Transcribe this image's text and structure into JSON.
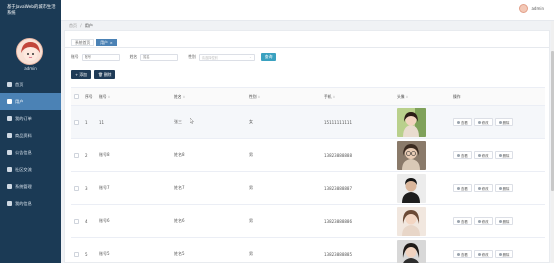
{
  "sidebar": {
    "app_title": "基于JavaWeb的城市生活系统",
    "username": "admin",
    "items": [
      {
        "label": "首页",
        "icon": "home-icon"
      },
      {
        "label": "用户",
        "icon": "user-icon"
      },
      {
        "label": "我的订单",
        "icon": "order-icon"
      },
      {
        "label": "商品资料",
        "icon": "goods-icon"
      },
      {
        "label": "公告信息",
        "icon": "notice-icon"
      },
      {
        "label": "社区交流",
        "icon": "community-icon"
      },
      {
        "label": "系统管理",
        "icon": "settings-icon"
      },
      {
        "label": "我的信息",
        "icon": "profile-icon"
      }
    ],
    "active_index": 1
  },
  "header": {
    "username": "admin"
  },
  "breadcrumb": {
    "home": "首页",
    "separator": "/",
    "current": "用户"
  },
  "tabs": [
    {
      "label": "系统首页",
      "active": false
    },
    {
      "label": "用户",
      "active": true,
      "close": "×"
    }
  ],
  "filters": {
    "account_label": "账号",
    "account_placeholder": "账号",
    "name_label": "姓名",
    "name_placeholder": "姓名",
    "gender_label": "性别",
    "gender_placeholder": "请选择性别",
    "query_button": "查询"
  },
  "actions": {
    "add_label": "+ 添加",
    "delete_label": "删除"
  },
  "table": {
    "headers": {
      "index": "序号",
      "account": "账号",
      "name": "姓名",
      "gender": "性别",
      "phone": "手机",
      "avatar": "头像",
      "ops": "操作"
    },
    "op_labels": {
      "view": "查看",
      "edit": "修改",
      "delete": "删除"
    },
    "rows": [
      {
        "index": "1",
        "account": "11",
        "name": "张三",
        "gender": "女",
        "phone": "15111111111"
      },
      {
        "index": "2",
        "account": "账号8",
        "name": "姓名8",
        "gender": "男",
        "phone": "13823888888"
      },
      {
        "index": "3",
        "account": "账号7",
        "name": "姓名7",
        "gender": "男",
        "phone": "13823888887"
      },
      {
        "index": "4",
        "account": "账号6",
        "name": "姓名6",
        "gender": "男",
        "phone": "13823888886"
      },
      {
        "index": "5",
        "account": "账号5",
        "name": "姓名5",
        "gender": "男",
        "phone": "13823888885"
      }
    ]
  },
  "colors": {
    "sidebar_bg": "#1b3a55",
    "active_menu": "#4b82b5",
    "query_button": "#3aa1c0",
    "action_button": "#1f3b57"
  }
}
